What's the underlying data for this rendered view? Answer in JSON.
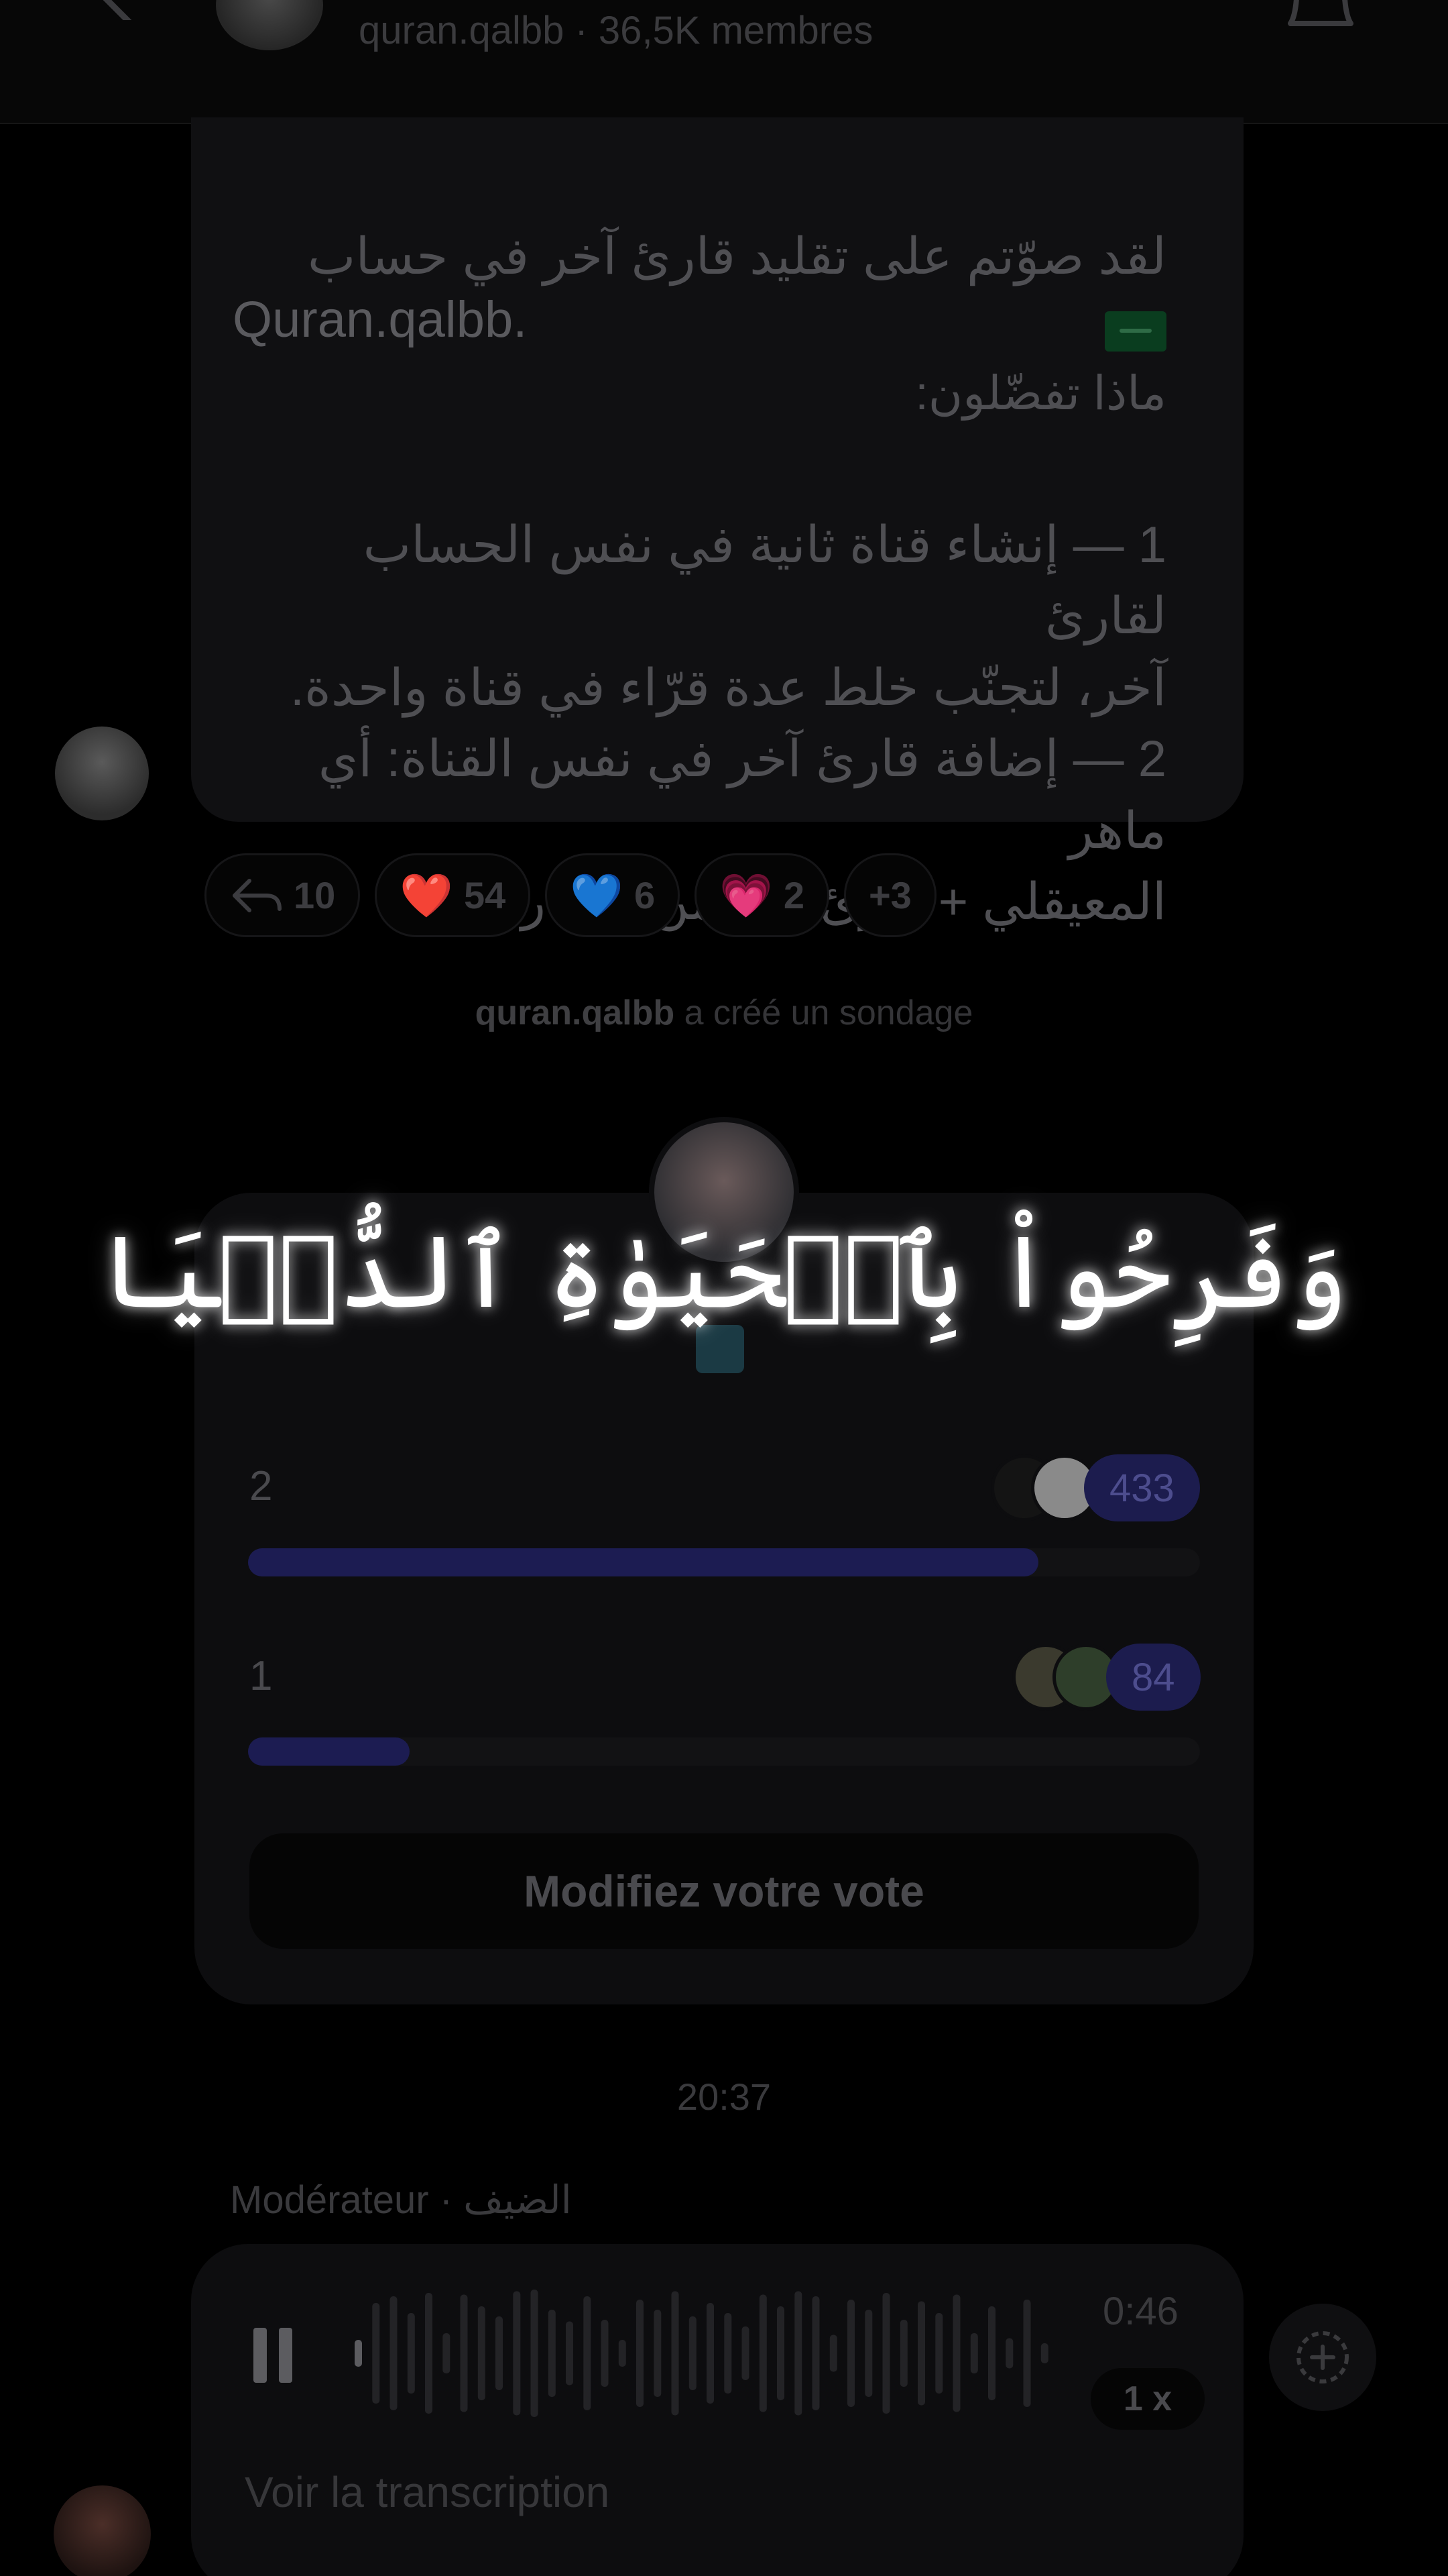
{
  "header": {
    "channel_handle": "quran.qalbb",
    "member_count": "· 36,5K membres"
  },
  "message": {
    "line1": "لقد صوّتم على تقليد قارئ آخر في حساب",
    "line1_icon": "saudi-flag-icon",
    "line2": "Quran.qalbb.",
    "line3": "ماذا تفضّلون:",
    "option1_line1": "1 — إنشاء قناة ثانية في نفس الحساب لقارئ",
    "option1_line2": "آخر، لتجنّب خلط عدة قرّاء في قناة واحدة.",
    "option2_line1": "2 — إضافة قارئ آخر في نفس القناة: أي ماهر",
    "option2_line2": "المعيقلي + قارئ آخر من اختياركم."
  },
  "reactions": [
    {
      "icon": "reply-icon",
      "count": "10"
    },
    {
      "icon": "❤️",
      "count": "54"
    },
    {
      "icon": "💙",
      "count": "6"
    },
    {
      "icon": "💗",
      "count": "2"
    },
    {
      "icon": "",
      "count": "+3"
    }
  ],
  "system_note": {
    "author": "quran.qalbb",
    "text": " a créé un sondage"
  },
  "poll": {
    "options": [
      {
        "label": "2",
        "votes": "433",
        "fraction": 0.83
      },
      {
        "label": "1",
        "votes": "84",
        "fraction": 0.17
      }
    ],
    "change_vote_label": "Modifiez votre vote"
  },
  "timestamp": "20:37",
  "sender": "Modérateur · الضيف",
  "audio": {
    "duration": "0:46",
    "speed": "1 x",
    "transcript_label": "Voir la transcription"
  },
  "overlay_verse": "وَفَرِحُواْ بِٱلۡحَيَوٰةِ ٱلدُّنۡيَا",
  "colors": {
    "background": "#000000",
    "card": "#0d0d0f",
    "poll_accent": "#1c1c52",
    "verse_text": "#ffffff"
  }
}
